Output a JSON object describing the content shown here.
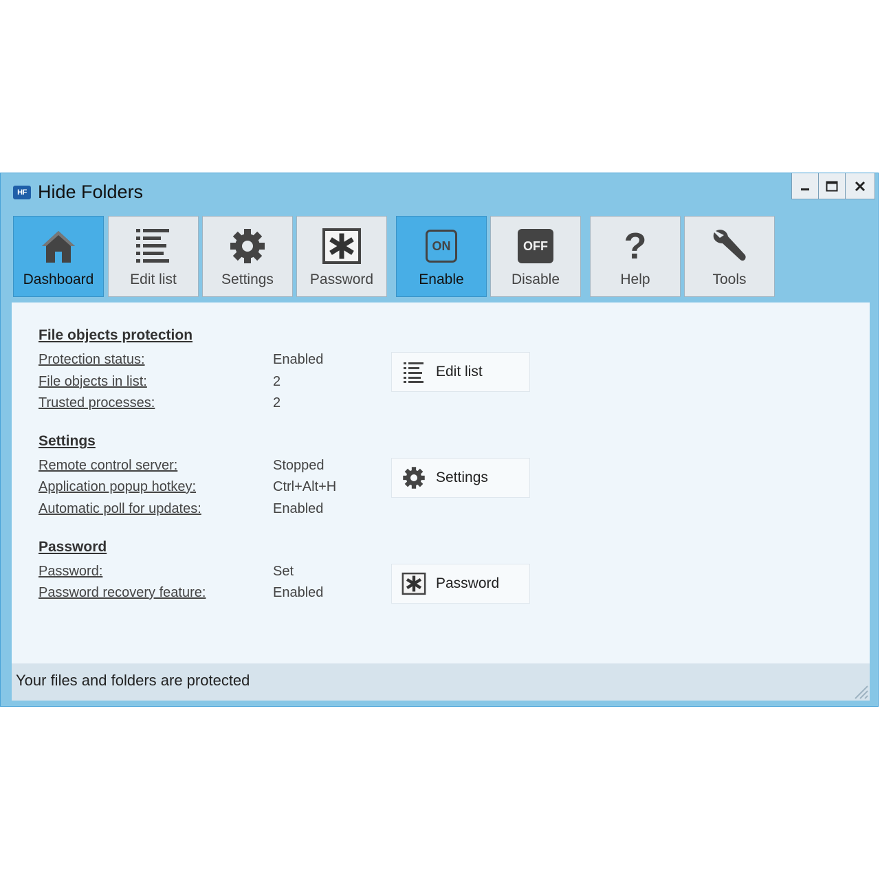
{
  "window": {
    "title": "Hide Folders",
    "icon_text": "HF",
    "controls": [
      "minimize-icon",
      "maximize-icon",
      "close-icon"
    ]
  },
  "toolbar": {
    "items": [
      {
        "label": "Dashboard",
        "icon": "home-icon",
        "active": true
      },
      {
        "label": "Edit list",
        "icon": "list-icon",
        "active": false
      },
      {
        "label": "Settings",
        "icon": "gear-icon",
        "active": false
      },
      {
        "label": "Password",
        "icon": "asterisk-icon",
        "active": false
      },
      {
        "label": "Enable",
        "icon": "on-icon",
        "icon_text": "ON",
        "active": true
      },
      {
        "label": "Disable",
        "icon": "off-icon",
        "icon_text": "OFF",
        "active": false
      },
      {
        "label": "Help",
        "icon": "question-icon",
        "icon_text": "?",
        "active": false
      },
      {
        "label": "Tools",
        "icon": "wrench-icon",
        "active": false
      }
    ]
  },
  "sections": {
    "protection": {
      "title": "File objects protection",
      "rows": [
        {
          "label": "Protection status:",
          "value": "Enabled"
        },
        {
          "label": "File objects in list:",
          "value": "2"
        },
        {
          "label": "Trusted processes:",
          "value": "2"
        }
      ],
      "button": "Edit list"
    },
    "settings": {
      "title": "Settings",
      "rows": [
        {
          "label": "Remote control server:",
          "value": "Stopped"
        },
        {
          "label": "Application popup hotkey:",
          "value": "Ctrl+Alt+H"
        },
        {
          "label": "Automatic poll for updates:",
          "value": "Enabled"
        }
      ],
      "button": "Settings"
    },
    "password": {
      "title": "Password",
      "rows": [
        {
          "label": "Password:",
          "value": "Set"
        },
        {
          "label": "Password recovery feature:",
          "value": "Enabled"
        }
      ],
      "button": "Password"
    }
  },
  "status": {
    "text": "Your files and folders are protected"
  },
  "colors": {
    "window_frame": "#86c6e6",
    "active_button": "#48aee6",
    "content_bg": "#eff6fb"
  }
}
